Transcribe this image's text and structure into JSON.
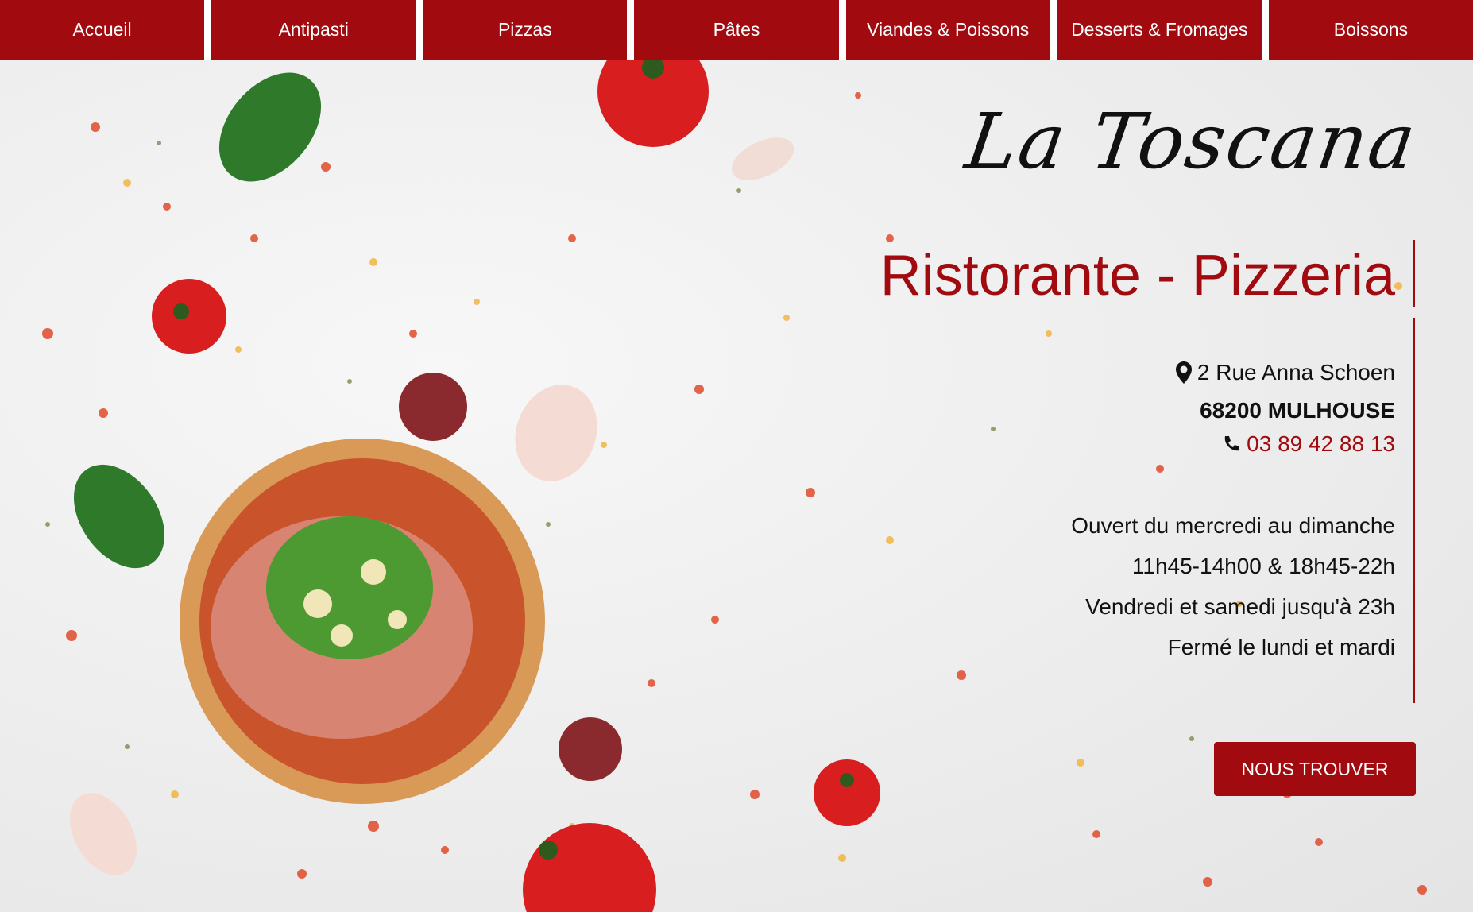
{
  "nav": {
    "items": [
      {
        "label": "Accueil"
      },
      {
        "label": "Antipasti"
      },
      {
        "label": "Pizzas"
      },
      {
        "label": "Pâtes"
      },
      {
        "label": "Viandes & Poissons"
      },
      {
        "label": "Desserts & Fromages"
      },
      {
        "label": "Boissons"
      }
    ]
  },
  "brand": {
    "logo_text": "La Toscana",
    "subtitle": "Ristorante - Pizzeria"
  },
  "contact": {
    "address_line1": "2 Rue Anna Schoen",
    "address_line2": "68200 MULHOUSE",
    "phone": "03 89 42 88 13",
    "address_icon": "map-marker-icon",
    "phone_icon": "phone-icon"
  },
  "hours": {
    "line1": "Ouvert du mercredi au dimanche",
    "line2": "11h45-14h00 & 18h45-22h",
    "line3": "Vendredi et samedi jusqu'à 23h",
    "line4": "Fermé le lundi et mardi"
  },
  "cta": {
    "label": "NOUS TROUVER"
  },
  "colors": {
    "accent": "#a10b10",
    "text": "#111111",
    "nav_text": "#ffffff"
  }
}
